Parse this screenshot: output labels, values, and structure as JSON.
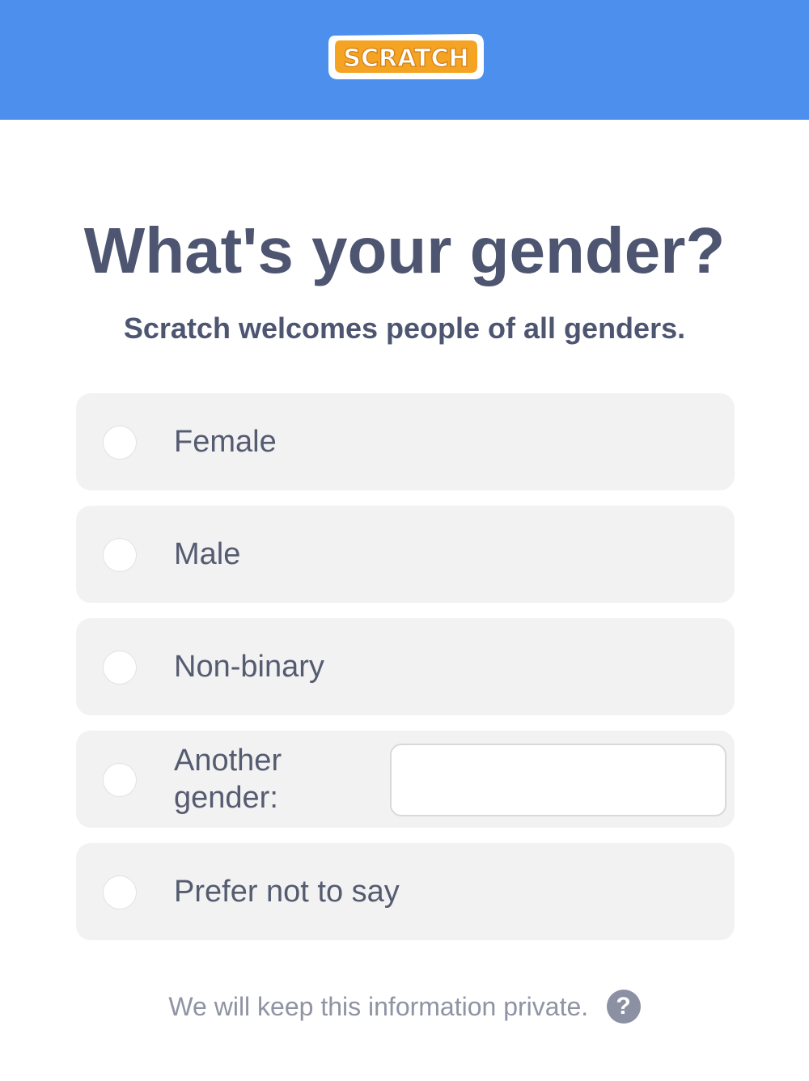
{
  "header": {
    "logo_text": "SCRATCH",
    "background_color": "#4c8fed"
  },
  "main": {
    "title": "What's your gender?",
    "subtitle": "Scratch welcomes people of all genders."
  },
  "options": [
    {
      "label": "Female",
      "selected": false
    },
    {
      "label": "Male",
      "selected": false
    },
    {
      "label": "Non-binary",
      "selected": false
    },
    {
      "label": "Another gender:",
      "selected": false,
      "input_value": "",
      "input_placeholder": ""
    },
    {
      "label": "Prefer not to say",
      "selected": false
    }
  ],
  "footer": {
    "privacy_text": "We will keep this information private.",
    "help_icon": "question-mark-icon",
    "help_symbol": "?"
  },
  "colors": {
    "text_primary": "#4d5570",
    "option_bg": "#f2f2f2",
    "logo_orange": "#f4a322"
  }
}
